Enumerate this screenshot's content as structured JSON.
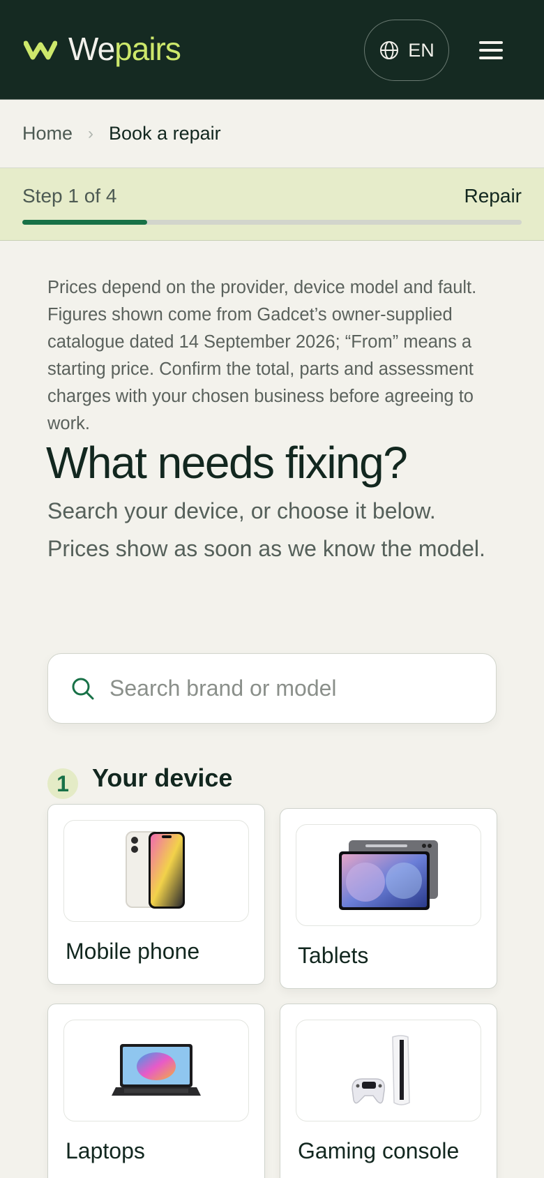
{
  "header": {
    "logo_we": "We",
    "logo_pairs": "pairs",
    "language": "EN"
  },
  "breadcrumb": {
    "home": "Home",
    "current": "Book a repair"
  },
  "step": {
    "text": "Step 1 of 4",
    "label": "Repair",
    "progress_fraction": 0.25
  },
  "notice": "Prices depend on the provider, device model and fault. Figures shown come from Gadcet’s owner-supplied catalogue dated 14 September 2026; “From” means a starting price. Confirm the total, parts and assessment charges with your chosen business before agreeing to work.",
  "title": "What needs fixing?",
  "subtitle": "Search your device, or choose it below. Prices show as soon as we know the model.",
  "search": {
    "placeholder": "Search brand or model"
  },
  "section": {
    "number": "1",
    "title": "Your device"
  },
  "devices": [
    {
      "label": "Mobile phone",
      "icon": "mobile-phone-image"
    },
    {
      "label": "Tablets",
      "icon": "tablet-image"
    },
    {
      "label": "Laptops",
      "icon": "laptop-image"
    },
    {
      "label": "Gaming console",
      "icon": "gaming-console-image"
    }
  ],
  "colors": {
    "header_bg": "#152a22",
    "accent_lime": "#cde86b",
    "accent_green": "#187147",
    "page_bg": "#f3f2ec"
  }
}
